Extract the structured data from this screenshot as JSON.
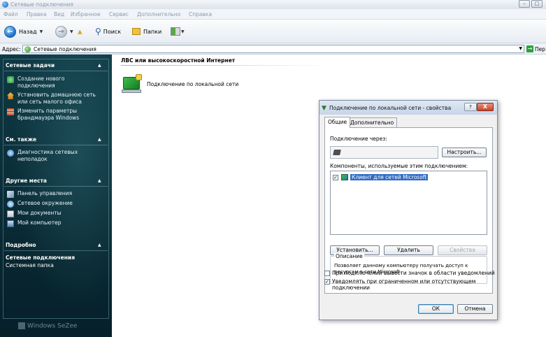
{
  "window": {
    "title": "Сетевые подключения",
    "buttons": [
      "–",
      "□"
    ]
  },
  "menu": [
    "Файл",
    "Правка",
    "Вид",
    "Избранное",
    "Сервис",
    "Дополнительно",
    "Справка"
  ],
  "toolbar": {
    "back_label": "Назад",
    "search_label": "Поиск",
    "folders_label": "Папки"
  },
  "address": {
    "label": "Адрес:",
    "value": "Сетевые подключения",
    "go_label": "Пер"
  },
  "leftpane": {
    "network_tasks": {
      "title": "Сетевые задачи",
      "items": [
        "Создание нового\nподключения",
        "Установить домашнюю сеть\nили сеть малого офиса",
        "Изменить параметры\nбрандмауэра Windows"
      ]
    },
    "see_also": {
      "title": "См. также",
      "items": [
        "Диагностика сетевых\nнеполадок"
      ]
    },
    "other_places": {
      "title": "Другие места",
      "items": [
        "Панель управления",
        "Сетевое окружение",
        "Мои документы",
        "Мой компьютер"
      ]
    },
    "details": {
      "title": "Подробно",
      "name": "Сетевые подключения",
      "type": "Системная папка"
    },
    "logo_text": "Windows SeZee"
  },
  "main": {
    "group_header": "ЛВС или высокоскоростной Интернет",
    "connection_label": "Подключение по локальной сети"
  },
  "dialog": {
    "title": "Подключение по локальной сети - свойства",
    "help": "?",
    "close": "X",
    "tabs": [
      "Общие",
      "Дополнительно"
    ],
    "connect_using_label": "Подключение через:",
    "configure_button": "Настроить...",
    "components_label": "Компоненты, используемые этим подключением:",
    "components": [
      {
        "label": "Клиент для сетей Microsoft",
        "checked": true
      }
    ],
    "install_button": "Установить...",
    "uninstall_button": "Удалить",
    "properties_button": "Свойства",
    "description_legend": "Описание",
    "description_text": "Позволяет данному компьютеру получать доступ к\nресурсам в сети Microsoft.",
    "show_icon_label": "При подключении вывести значок в области уведомлений",
    "notify_label": "Уведомлять при ограниченном или отсутствующем\nподключении",
    "ok_button": "ОК",
    "cancel_button": "Отмена"
  }
}
